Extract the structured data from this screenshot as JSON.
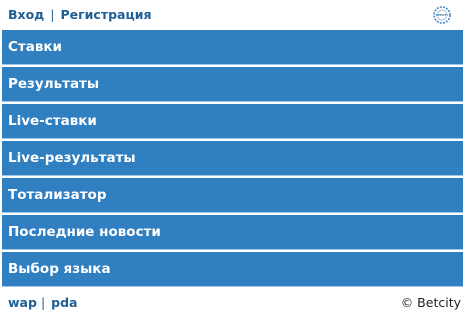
{
  "header": {
    "login_label": "Вход",
    "separator": "|",
    "register_label": "Регистрация",
    "logo_icon": "betcity-logo-icon",
    "logo_text": "BETCITY"
  },
  "menu": {
    "items": [
      {
        "label": "Ставки"
      },
      {
        "label": "Результаты"
      },
      {
        "label": "Live-ставки"
      },
      {
        "label": "Live-результаты"
      },
      {
        "label": "Тотализатор"
      },
      {
        "label": "Последние новости"
      },
      {
        "label": "Выбор языка"
      }
    ]
  },
  "footer": {
    "wap_label": "wap",
    "separator": "|",
    "pda_label": "pda",
    "copyright": "© Betcity"
  },
  "colors": {
    "menu_background": "#2f7fc1",
    "menu_divider": "#9fc6e6",
    "link": "#1f5f95",
    "menu_text": "#ffffff"
  }
}
